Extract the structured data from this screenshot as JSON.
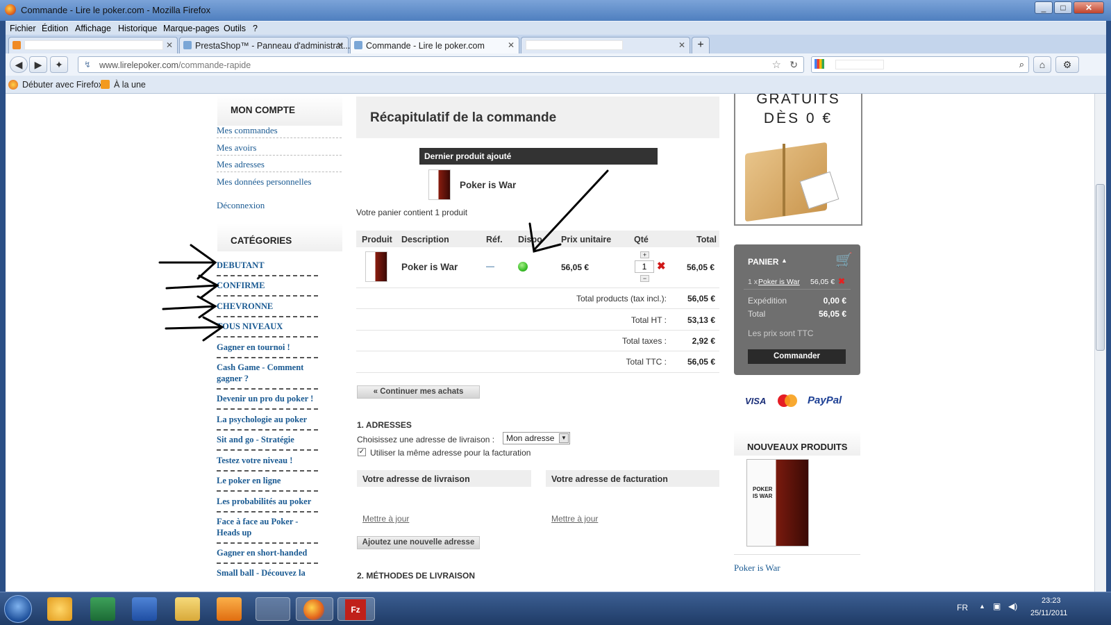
{
  "window": {
    "title": "Commande - Lire le poker.com - Mozilla Firefox"
  },
  "menu": [
    "Fichier",
    "Édition",
    "Affichage",
    "Historique",
    "Marque-pages",
    "Outils",
    "?"
  ],
  "tabs": [
    {
      "label": "",
      "active": false
    },
    {
      "label": "PrestaShop™ - Panneau d'administrat...",
      "active": false
    },
    {
      "label": "Commande - Lire le poker.com",
      "active": true
    },
    {
      "label": "",
      "active": false
    }
  ],
  "url": {
    "domain": "www.lirelepoker.com",
    "path": "/commande-rapide"
  },
  "bookmarks": [
    "Débuter avec Firefox",
    "À la une"
  ],
  "sidebar": {
    "account_title": "MON COMPTE",
    "account_links": [
      "Mes commandes",
      "Mes avoirs",
      "Mes adresses",
      "Mes données personnelles"
    ],
    "logout": "Déconnexion",
    "categories_title": "CATÉGORIES",
    "categories": [
      "DEBUTANT",
      "CONFIRME",
      "CHEVRONNE",
      "TOUS NIVEAUX",
      "Gagner en tournoi !",
      "Cash Game - Comment gagner ?",
      "Devenir un pro du poker !",
      "La psychologie au poker",
      "Sit and go - Stratégie",
      "Testez votre niveau !",
      "Le poker en ligne",
      "Les probabilités au poker",
      "Face à face au Poker - Heads up",
      "Gagner en short-handed",
      "Small ball - Découvez la"
    ]
  },
  "main": {
    "title": "Récapitulatif de la commande",
    "last_added_label": "Dernier produit ajouté",
    "last_added_product": "Poker is War",
    "cart_count_text": "Votre panier contient 1 produit",
    "columns": [
      "Produit",
      "Description",
      "Réf.",
      "Dispo",
      "Prix unitaire",
      "Qté",
      "Total"
    ],
    "item": {
      "description": "Poker is War",
      "ref": "—",
      "unit_price": "56,05 €",
      "qty": "1",
      "total": "56,05 €"
    },
    "totals": [
      {
        "label": "Total products (tax incl.):",
        "value": "56,05 €"
      },
      {
        "label": "Total HT :",
        "value": "53,13 €"
      },
      {
        "label": "Total taxes :",
        "value": "2,92 €"
      },
      {
        "label": "Total TTC :",
        "value": "56,05 €"
      }
    ],
    "continue_button": "« Continuer mes achats",
    "addresses_title": "1. ADRESSES",
    "choose_address_label": "Choisissez une adresse de livraison :",
    "address_select": "Mon adresse",
    "same_address_label": "Utiliser la même adresse pour la facturation",
    "delivery_address_title": "Votre adresse de livraison",
    "billing_address_title": "Votre adresse de facturation",
    "update_link": "Mettre à jour",
    "add_address_button": "Ajoutez une nouvelle adresse",
    "shipping_title": "2. MÉTHODES DE LIVRAISON"
  },
  "right": {
    "promo_line1": "GRATUITS",
    "promo_line2": "DÈS 0 €",
    "cart_title": "PANIER",
    "cart_item_qty": "1 x",
    "cart_item_name": "Poker is War",
    "cart_item_price": "56,05 €",
    "shipping_label": "Expédition",
    "shipping_value": "0,00 €",
    "total_label": "Total",
    "total_value": "56,05 €",
    "ttc_note": "Les prix sont TTC",
    "order_button": "Commander",
    "payment": [
      "VISA",
      "MasterCard",
      "PayPal"
    ],
    "new_products_title": "NOUVEAUX PRODUITS",
    "book_title_line1": "POKER",
    "book_title_line2": "IS WAR",
    "new_product_link": "Poker is War"
  },
  "taskbar": {
    "lang": "FR",
    "time": "23:23",
    "date": "25/11/2011"
  },
  "colors": {
    "link": "#1a5a92",
    "cart_bg": "#6f6f6f",
    "in_stock": "#3cbf2a",
    "remove": "#d01818"
  }
}
